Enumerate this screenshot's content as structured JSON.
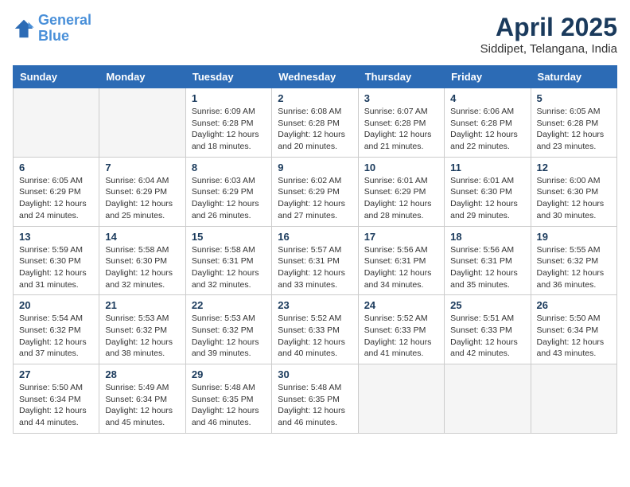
{
  "header": {
    "logo_line1": "General",
    "logo_line2": "Blue",
    "month_title": "April 2025",
    "location": "Siddipet, Telangana, India"
  },
  "days_of_week": [
    "Sunday",
    "Monday",
    "Tuesday",
    "Wednesday",
    "Thursday",
    "Friday",
    "Saturday"
  ],
  "weeks": [
    [
      {
        "day": "",
        "empty": true
      },
      {
        "day": "",
        "empty": true
      },
      {
        "day": "1",
        "sunrise": "6:09 AM",
        "sunset": "6:28 PM",
        "daylight": "12 hours and 18 minutes."
      },
      {
        "day": "2",
        "sunrise": "6:08 AM",
        "sunset": "6:28 PM",
        "daylight": "12 hours and 20 minutes."
      },
      {
        "day": "3",
        "sunrise": "6:07 AM",
        "sunset": "6:28 PM",
        "daylight": "12 hours and 21 minutes."
      },
      {
        "day": "4",
        "sunrise": "6:06 AM",
        "sunset": "6:28 PM",
        "daylight": "12 hours and 22 minutes."
      },
      {
        "day": "5",
        "sunrise": "6:05 AM",
        "sunset": "6:28 PM",
        "daylight": "12 hours and 23 minutes."
      }
    ],
    [
      {
        "day": "6",
        "sunrise": "6:05 AM",
        "sunset": "6:29 PM",
        "daylight": "12 hours and 24 minutes."
      },
      {
        "day": "7",
        "sunrise": "6:04 AM",
        "sunset": "6:29 PM",
        "daylight": "12 hours and 25 minutes."
      },
      {
        "day": "8",
        "sunrise": "6:03 AM",
        "sunset": "6:29 PM",
        "daylight": "12 hours and 26 minutes."
      },
      {
        "day": "9",
        "sunrise": "6:02 AM",
        "sunset": "6:29 PM",
        "daylight": "12 hours and 27 minutes."
      },
      {
        "day": "10",
        "sunrise": "6:01 AM",
        "sunset": "6:29 PM",
        "daylight": "12 hours and 28 minutes."
      },
      {
        "day": "11",
        "sunrise": "6:01 AM",
        "sunset": "6:30 PM",
        "daylight": "12 hours and 29 minutes."
      },
      {
        "day": "12",
        "sunrise": "6:00 AM",
        "sunset": "6:30 PM",
        "daylight": "12 hours and 30 minutes."
      }
    ],
    [
      {
        "day": "13",
        "sunrise": "5:59 AM",
        "sunset": "6:30 PM",
        "daylight": "12 hours and 31 minutes."
      },
      {
        "day": "14",
        "sunrise": "5:58 AM",
        "sunset": "6:30 PM",
        "daylight": "12 hours and 32 minutes."
      },
      {
        "day": "15",
        "sunrise": "5:58 AM",
        "sunset": "6:31 PM",
        "daylight": "12 hours and 32 minutes."
      },
      {
        "day": "16",
        "sunrise": "5:57 AM",
        "sunset": "6:31 PM",
        "daylight": "12 hours and 33 minutes."
      },
      {
        "day": "17",
        "sunrise": "5:56 AM",
        "sunset": "6:31 PM",
        "daylight": "12 hours and 34 minutes."
      },
      {
        "day": "18",
        "sunrise": "5:56 AM",
        "sunset": "6:31 PM",
        "daylight": "12 hours and 35 minutes."
      },
      {
        "day": "19",
        "sunrise": "5:55 AM",
        "sunset": "6:32 PM",
        "daylight": "12 hours and 36 minutes."
      }
    ],
    [
      {
        "day": "20",
        "sunrise": "5:54 AM",
        "sunset": "6:32 PM",
        "daylight": "12 hours and 37 minutes."
      },
      {
        "day": "21",
        "sunrise": "5:53 AM",
        "sunset": "6:32 PM",
        "daylight": "12 hours and 38 minutes."
      },
      {
        "day": "22",
        "sunrise": "5:53 AM",
        "sunset": "6:32 PM",
        "daylight": "12 hours and 39 minutes."
      },
      {
        "day": "23",
        "sunrise": "5:52 AM",
        "sunset": "6:33 PM",
        "daylight": "12 hours and 40 minutes."
      },
      {
        "day": "24",
        "sunrise": "5:52 AM",
        "sunset": "6:33 PM",
        "daylight": "12 hours and 41 minutes."
      },
      {
        "day": "25",
        "sunrise": "5:51 AM",
        "sunset": "6:33 PM",
        "daylight": "12 hours and 42 minutes."
      },
      {
        "day": "26",
        "sunrise": "5:50 AM",
        "sunset": "6:34 PM",
        "daylight": "12 hours and 43 minutes."
      }
    ],
    [
      {
        "day": "27",
        "sunrise": "5:50 AM",
        "sunset": "6:34 PM",
        "daylight": "12 hours and 44 minutes."
      },
      {
        "day": "28",
        "sunrise": "5:49 AM",
        "sunset": "6:34 PM",
        "daylight": "12 hours and 45 minutes."
      },
      {
        "day": "29",
        "sunrise": "5:48 AM",
        "sunset": "6:35 PM",
        "daylight": "12 hours and 46 minutes."
      },
      {
        "day": "30",
        "sunrise": "5:48 AM",
        "sunset": "6:35 PM",
        "daylight": "12 hours and 46 minutes."
      },
      {
        "day": "",
        "empty": true
      },
      {
        "day": "",
        "empty": true
      },
      {
        "day": "",
        "empty": true
      }
    ]
  ]
}
